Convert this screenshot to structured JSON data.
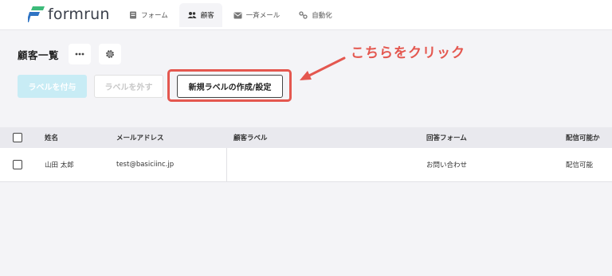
{
  "app": {
    "brand": "formrun",
    "brand_colors": {
      "green": "#3dbb7a",
      "blue": "#2f74c4"
    }
  },
  "nav": {
    "tabs": [
      {
        "label": "フォーム",
        "icon": "form-icon",
        "active": false
      },
      {
        "label": "顧客",
        "icon": "users-icon",
        "active": true
      },
      {
        "label": "一斉メール",
        "icon": "mail-icon",
        "active": false
      },
      {
        "label": "自動化",
        "icon": "automation-icon",
        "active": false
      }
    ]
  },
  "page": {
    "title": "顧客一覧",
    "more_icon": "more-horizontal-icon",
    "settings_icon": "gear-icon"
  },
  "toolbar": {
    "add_label": "ラベルを付与",
    "remove_label": "ラベルを外す",
    "new_label": "新規ラベルの作成/設定"
  },
  "annotation": {
    "callout": "こちらをクリック",
    "color": "#e4574f"
  },
  "table": {
    "columns": [
      "姓名",
      "メールアドレス",
      "顧客ラベル",
      "回答フォーム",
      "配信可能か"
    ],
    "rows": [
      {
        "name": "山田 太郎",
        "email": "test@basiciinc.jp",
        "label": "",
        "form": "お問い合わせ",
        "deliverable": "配信可能"
      }
    ]
  }
}
